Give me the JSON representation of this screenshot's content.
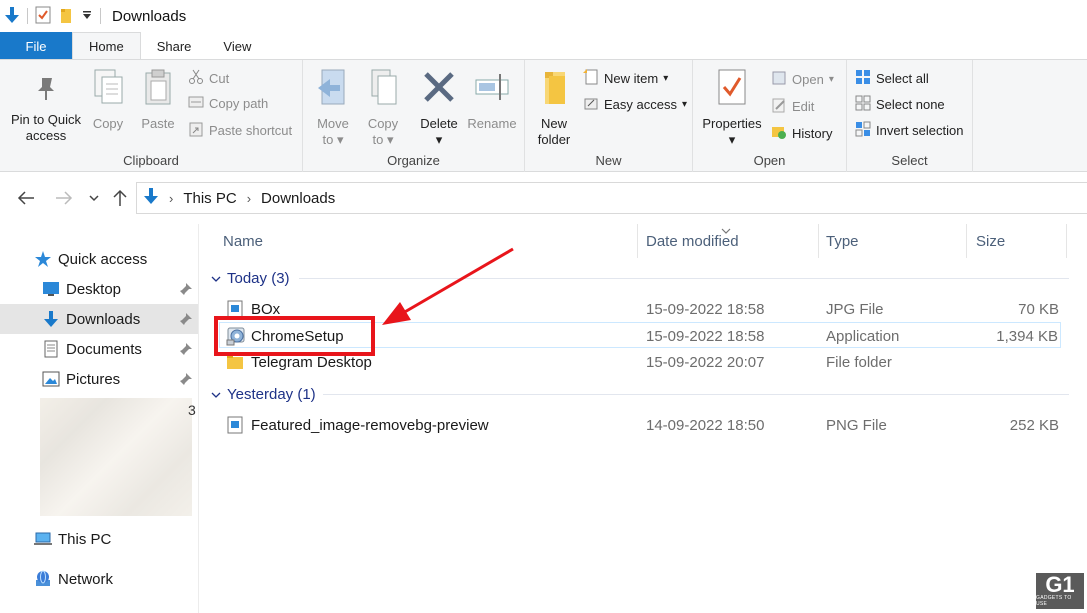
{
  "window": {
    "title": "Downloads"
  },
  "ribbon_tabs": [
    "File",
    "Home",
    "Share",
    "View"
  ],
  "ribbon": {
    "clipboard": {
      "label": "Clipboard",
      "pin_line1": "Pin to Quick",
      "pin_line2": "access",
      "copy": "Copy",
      "paste": "Paste",
      "cut": "Cut",
      "copy_path": "Copy path",
      "paste_shortcut": "Paste shortcut"
    },
    "organize": {
      "label": "Organize",
      "move_line1": "Move",
      "move_line2": "to",
      "copy_line1": "Copy",
      "copy_line2": "to",
      "delete": "Delete",
      "rename": "Rename"
    },
    "new": {
      "label": "New",
      "folder_line1": "New",
      "folder_line2": "folder",
      "new_item": "New item",
      "easy_access": "Easy access"
    },
    "open": {
      "label": "Open",
      "properties": "Properties",
      "open": "Open",
      "edit": "Edit",
      "history": "History"
    },
    "select": {
      "label": "Select",
      "select_all": "Select all",
      "select_none": "Select none",
      "invert": "Invert selection"
    }
  },
  "address": {
    "crumbs": [
      "This PC",
      "Downloads"
    ]
  },
  "nav_pane": {
    "quick_access": "Quick access",
    "items": [
      "Desktop",
      "Downloads",
      "Documents",
      "Pictures"
    ],
    "blur_digit": "3",
    "this_pc": "This PC",
    "network": "Network"
  },
  "columns": {
    "name": "Name",
    "date": "Date modified",
    "type": "Type",
    "size": "Size"
  },
  "groups": [
    {
      "label": "Today (3)",
      "files": [
        {
          "name": "BOx",
          "date": "15-09-2022 18:58",
          "type": "JPG File",
          "size": "70 KB"
        },
        {
          "name": "ChromeSetup",
          "date": "15-09-2022 18:58",
          "type": "Application",
          "size": "1,394 KB"
        },
        {
          "name": "Telegram Desktop",
          "date": "15-09-2022 20:07",
          "type": "File folder",
          "size": ""
        }
      ]
    },
    {
      "label": "Yesterday (1)",
      "files": [
        {
          "name": "Featured_image-removebg-preview",
          "date": "14-09-2022 18:50",
          "type": "PNG File",
          "size": "252 KB"
        }
      ]
    }
  ],
  "watermark": {
    "logo": "G1",
    "tagline": "GADGETS TO USE"
  },
  "colors": {
    "accent": "#1979ca",
    "annotation_red": "#e8151b",
    "group_header": "#1e3287"
  }
}
